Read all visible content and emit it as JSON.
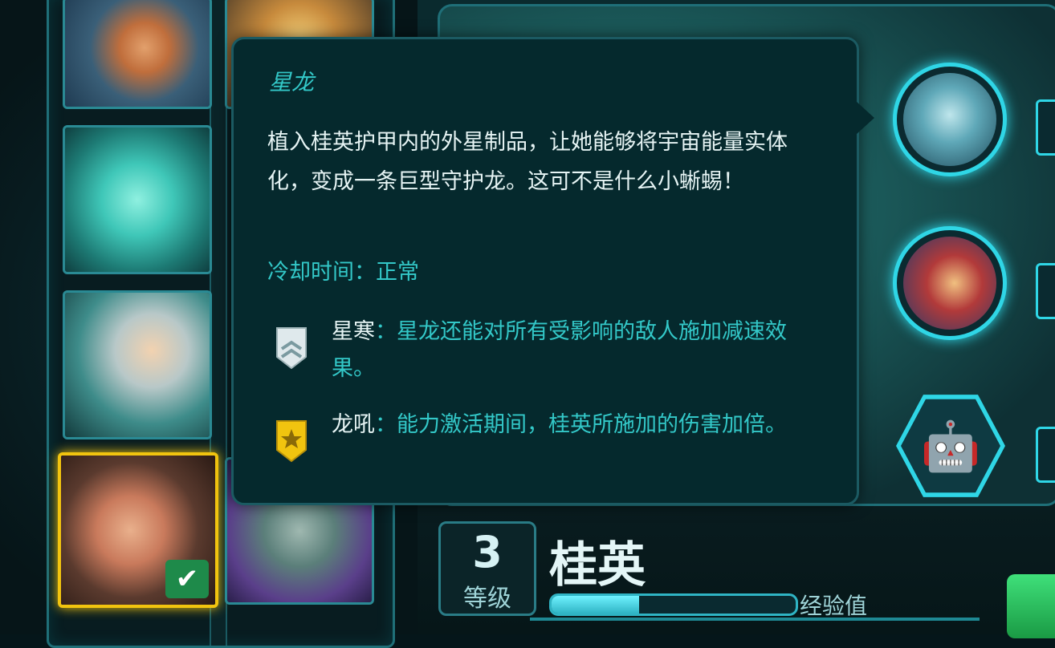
{
  "tooltip": {
    "title": "星龙",
    "description": "植入桂英护甲内的外星制品，让她能够将宇宙能量实体化，变成一条巨型守护龙。这可不是什么小蜥蜴！",
    "cooldown_label": "冷却时间：",
    "cooldown_value": "正常",
    "upgrades": [
      {
        "name": "星寒",
        "colon": "：",
        "description": "星龙还能对所有受影响的敌人施加减速效果。",
        "icon": "chevron-rank-icon",
        "color": "#c8d8dc"
      },
      {
        "name": "龙吼",
        "colon": "：",
        "description": "能力激活期间，桂英所施加的伤害加倍。",
        "icon": "star-rank-icon",
        "color": "#f1c40f"
      }
    ]
  },
  "hero": {
    "level_number": "3",
    "level_label": "等级",
    "name": "桂英",
    "xp_label": "经验值",
    "xp_fraction": 0.36
  },
  "skills": [
    {
      "icon": "dragon-skill-icon"
    },
    {
      "icon": "duo-heroes-skill-icon"
    },
    {
      "icon": "mech-skill-icon",
      "glyph": "🤖"
    }
  ],
  "roster": {
    "selected_check": "✔"
  },
  "colors": {
    "accent": "#2fd6e6",
    "tooltip_bg": "#05292d",
    "highlight_text": "#33c8c8",
    "selected_frame": "#f1c40f"
  }
}
